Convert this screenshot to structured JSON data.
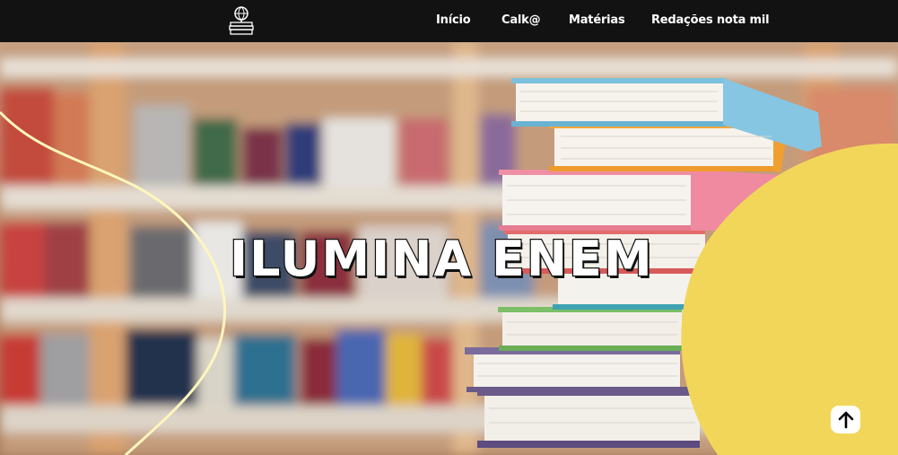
{
  "navbar": {
    "logo_icon": "globe-on-books-icon",
    "links": [
      "Início",
      "Calk@",
      "Matérias",
      "Redações nota mil"
    ]
  },
  "hero": {
    "title": "ILUMINA ENEM",
    "scroll_top_icon": "arrow-up-icon"
  },
  "colors": {
    "navbar_bg": "#121212",
    "accent_yellow": "#f2d65a",
    "curve_line": "#fff3b0",
    "text_white": "#ffffff"
  }
}
